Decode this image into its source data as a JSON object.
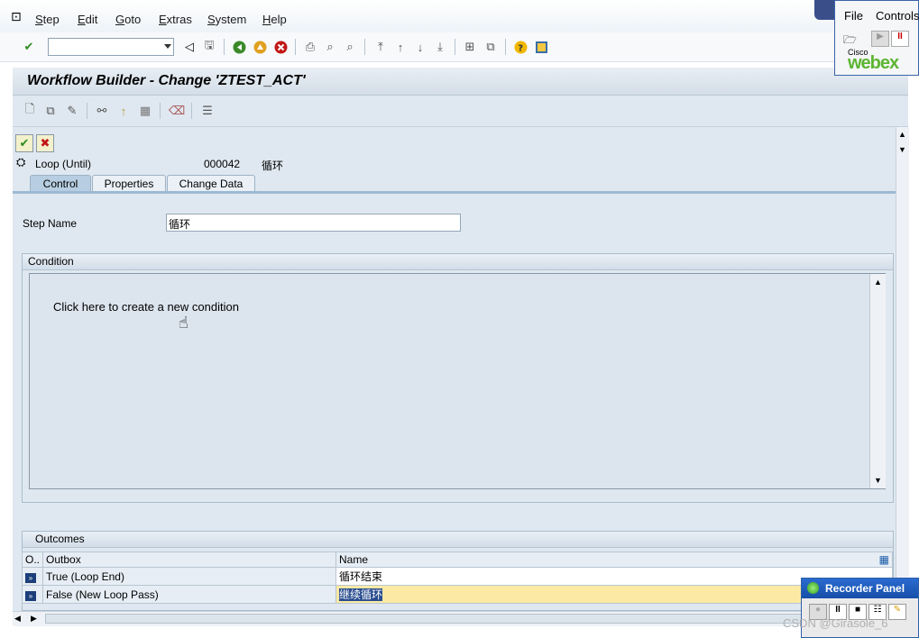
{
  "menu": {
    "items": [
      "Step",
      "Edit",
      "Goto",
      "Extras",
      "System",
      "Help"
    ]
  },
  "title": "Workflow Builder - Change 'ZTEST_ACT'",
  "step": {
    "type": "Loop (Until)",
    "number": "000042",
    "name": "循环"
  },
  "tabs": [
    "Control",
    "Properties",
    "Change Data"
  ],
  "active_tab": "Control",
  "form": {
    "step_name_label": "Step Name",
    "step_name_value": "循环"
  },
  "condition": {
    "group_title": "Condition",
    "link_text": "Click here to create a new condition"
  },
  "outcomes": {
    "group_title": "Outcomes",
    "columns": [
      "O..",
      "Outbox",
      "Name"
    ],
    "rows": [
      {
        "outbox": "True (Loop End)",
        "name": "循环结束"
      },
      {
        "outbox": "False (New Loop Pass)",
        "name": "继续循环"
      }
    ]
  },
  "webex": {
    "menu_file": "File",
    "menu_controls": "Controls",
    "brand_small": "Cisco",
    "brand": "webex"
  },
  "recorder": {
    "title": "Recorder Panel"
  },
  "watermark": "CSDN @Girasole_6",
  "colors": {
    "confirm_green": "#2e8b1e",
    "cancel_red": "#c21818",
    "selected_cell": "#fbe9a4",
    "webex_green": "#5cb531"
  }
}
